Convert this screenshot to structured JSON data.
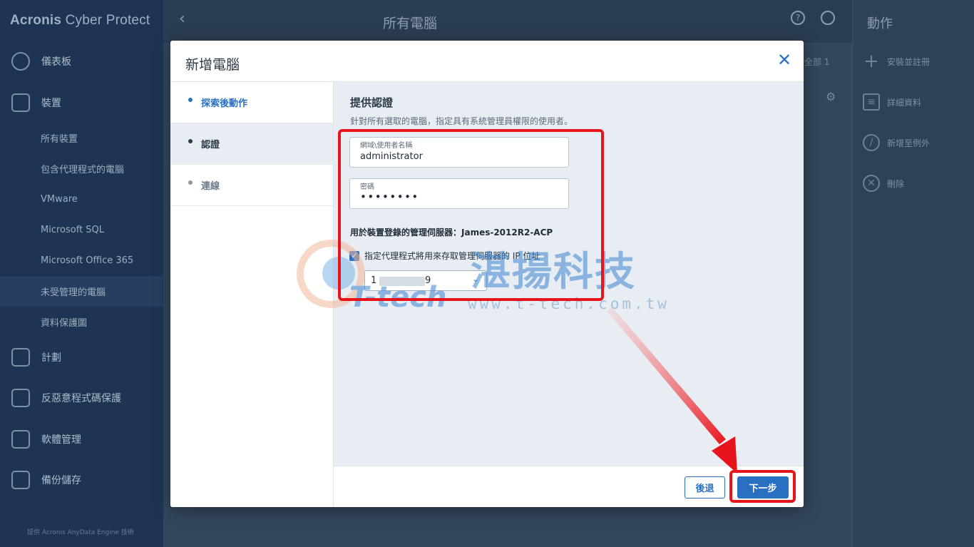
{
  "app": {
    "brand_main": "Acronis",
    "brand_sub": " Cyber Protect"
  },
  "sidebar": {
    "main_items": [
      {
        "label": "儀表板"
      },
      {
        "label": "裝置"
      },
      {
        "label": "計劃"
      },
      {
        "label": "反惡意程式碼保護"
      },
      {
        "label": "軟體管理"
      },
      {
        "label": "備份儲存"
      }
    ],
    "sub_items": [
      {
        "label": "所有裝置"
      },
      {
        "label": "包含代理程式的電腦"
      },
      {
        "label": "VMware"
      },
      {
        "label": "Microsoft SQL"
      },
      {
        "label": "Microsoft Office 365"
      },
      {
        "label": "未受管理的電腦"
      },
      {
        "label": "資料保護圖"
      }
    ],
    "footer": "提供 Acronis AnyData Engine 技術"
  },
  "topbar": {
    "page_title": "所有電腦",
    "help_glyph": "?",
    "filter_text": "全部 1"
  },
  "actions_panel": {
    "title": "動作",
    "items": [
      {
        "label": "安裝並註冊",
        "icon": "plus-icon"
      },
      {
        "label": "詳細資料",
        "icon": "details-icon"
      },
      {
        "label": "新增至例外",
        "icon": "block-icon"
      },
      {
        "label": "刪除",
        "icon": "delete-icon"
      }
    ]
  },
  "modal": {
    "title": "新增電腦",
    "steps": [
      {
        "label": "探索後動作"
      },
      {
        "label": "認證"
      },
      {
        "label": "連線"
      }
    ],
    "section_title": "提供認證",
    "section_desc": "針對所有選取的電腦，指定具有系統管理員權限的使用者。",
    "username": {
      "label": "網域\\使用者名稱",
      "value": "administrator"
    },
    "password": {
      "label": "密碼",
      "value": "••••••••"
    },
    "server_line": "用於裝置登錄的管理伺服器：James-2012R2-ACP",
    "checkbox_label": "指定代理程式將用來存取管理伺服器的 IP 位址",
    "checkbox_checked": true,
    "ip_value_start": "1",
    "ip_value_end": "9",
    "back_label": "後退",
    "next_label": "下一步"
  },
  "watermark": {
    "chinese": "湛揚科技",
    "brand": "T-tech",
    "url": "www.t-tech.com.tw"
  },
  "colors": {
    "accent": "#2a70c2",
    "highlight": "#e8141b"
  }
}
